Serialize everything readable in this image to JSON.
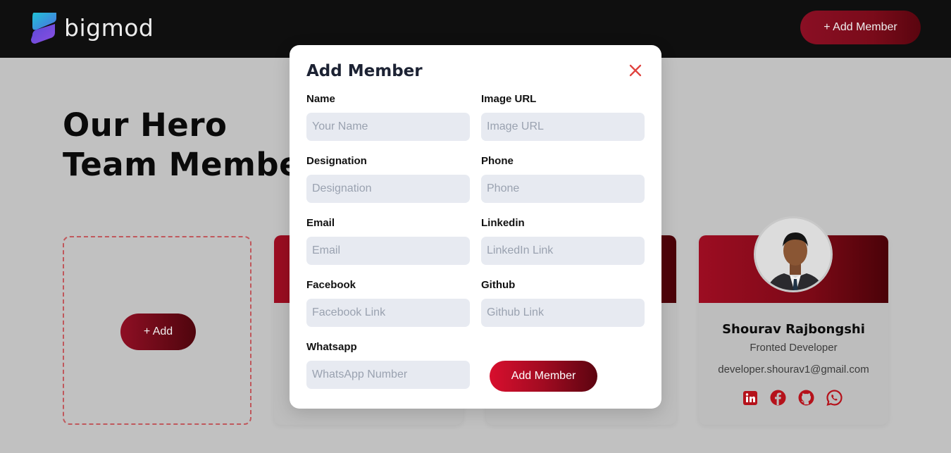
{
  "navbar": {
    "brand": "bigmod",
    "add_member_label": "+ Add Member"
  },
  "hero": {
    "line1": "Our Hero",
    "line2": "Team Members"
  },
  "add_card": {
    "button_label": "+ Add"
  },
  "member_card": {
    "name": "Shourav Rajbongshi",
    "role": "Fronted Developer",
    "email": "developer.shourav1@gmail.com",
    "socials": [
      "linkedin-icon",
      "facebook-icon",
      "github-icon",
      "whatsapp-icon"
    ]
  },
  "modal": {
    "title": "Add Member",
    "fields": [
      {
        "label": "Name",
        "placeholder": "Your Name"
      },
      {
        "label": "Image URL",
        "placeholder": "Image URL"
      },
      {
        "label": "Designation",
        "placeholder": "Designation"
      },
      {
        "label": "Phone",
        "placeholder": "Phone"
      },
      {
        "label": "Email",
        "placeholder": "Email"
      },
      {
        "label": "Linkedin",
        "placeholder": "LinkedIn Link"
      },
      {
        "label": "Facebook",
        "placeholder": "Facebook Link"
      },
      {
        "label": "Github",
        "placeholder": "Github Link"
      },
      {
        "label": "Whatsapp",
        "placeholder": "WhatsApp Number"
      }
    ],
    "submit_label": "Add Member"
  },
  "colors": {
    "accent": "#9c0d22",
    "accent_dark": "#4a0208",
    "social_red": "#b5121b",
    "close_red": "#e0433f"
  }
}
